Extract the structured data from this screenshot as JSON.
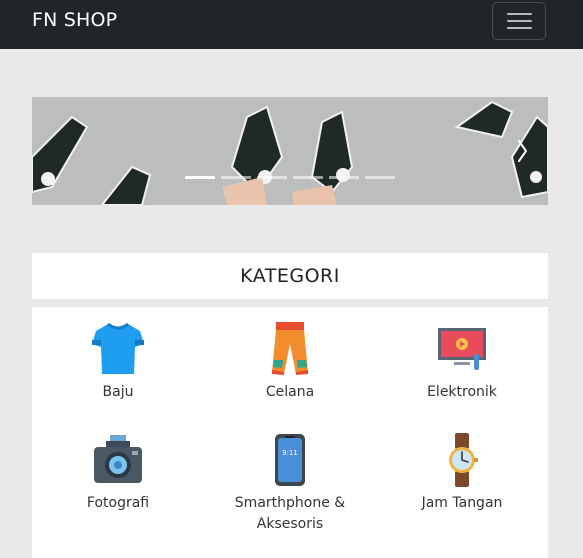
{
  "navbar": {
    "brand": "FN SHOP",
    "toggler_icon": "hamburger-menu-icon"
  },
  "carousel": {
    "slide_count": 6,
    "active_index": 0,
    "next_icon": "chevron-right-icon"
  },
  "categories": {
    "title": "KATEGORI",
    "items": [
      {
        "label": "Baju",
        "icon": "tshirt-icon"
      },
      {
        "label": "Celana",
        "icon": "pants-icon"
      },
      {
        "label": "Elektronik",
        "icon": "monitor-icon"
      },
      {
        "label": "Fotografi",
        "icon": "camera-icon"
      },
      {
        "label": "Smarthphone &\nAksesoris",
        "icon": "smartphone-icon"
      },
      {
        "label": "Jam Tangan",
        "icon": "wristwatch-icon"
      }
    ]
  },
  "colors": {
    "navbar": "#212529",
    "page_bg": "#e9e9e9",
    "panel_bg": "#ffffff"
  }
}
